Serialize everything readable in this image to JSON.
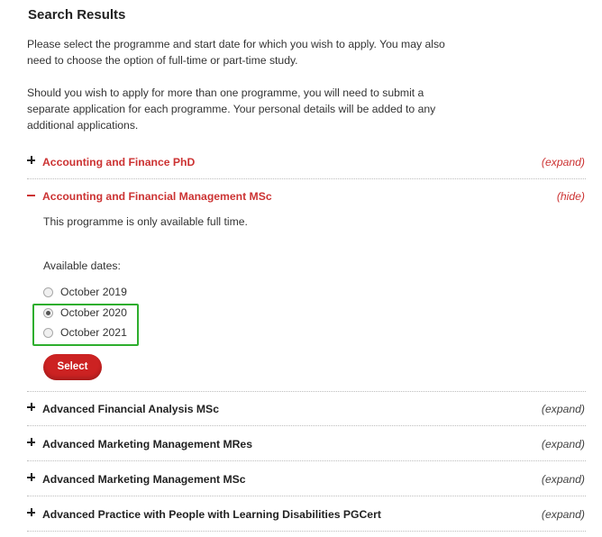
{
  "page": {
    "title": "Search Results",
    "intro_1": "Please select the programme and start date for which you wish to apply. You may also need to choose the option of full-time or part-time study.",
    "intro_2": "Should you wish to apply for more than one programme, you will need to submit a separate application for each programme. Your personal details will be added to any additional applications."
  },
  "programmes": [
    {
      "name": "Accounting and Finance PhD",
      "toggle": "(expand)"
    },
    {
      "name": "Accounting and Financial Management MSc",
      "toggle": "(hide)"
    },
    {
      "name": "Advanced Financial Analysis MSc",
      "toggle": "(expand)"
    },
    {
      "name": "Advanced Marketing Management MRes",
      "toggle": "(expand)"
    },
    {
      "name": "Advanced Marketing Management MSc",
      "toggle": "(expand)"
    },
    {
      "name": "Advanced Practice with People with Learning Disabilities PGCert",
      "toggle": "(expand)"
    }
  ],
  "expanded": {
    "note": "This programme is only available full time.",
    "available_label": "Available dates:",
    "dates": [
      {
        "label": "October 2019",
        "checked": false
      },
      {
        "label": "October 2020",
        "checked": true
      },
      {
        "label": "October 2021",
        "checked": false
      }
    ],
    "select_label": "Select"
  },
  "colors": {
    "accent": "#cc3333",
    "button": "#cc2222",
    "highlight": "#2eae2e"
  }
}
